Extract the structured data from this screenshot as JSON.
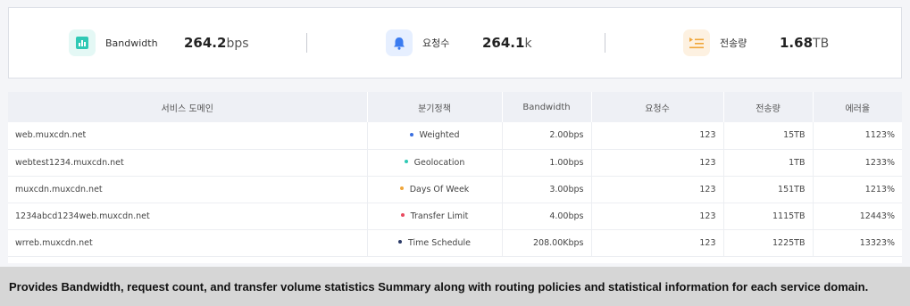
{
  "stats": [
    {
      "label": "Bandwidth",
      "value": "264.2",
      "unit": "bps",
      "icon": "bar-chart-icon",
      "icon_color": "#2fc9b5",
      "icon_bg": "#e4f8f5"
    },
    {
      "label": "요청수",
      "value": "264.1",
      "unit": "k",
      "icon": "bell-icon",
      "icon_color": "#3a7bf0",
      "icon_bg": "#e6efff"
    },
    {
      "label": "전송량",
      "value": "1.68",
      "unit": "TB",
      "icon": "list-play-icon",
      "icon_color": "#f0a63a",
      "icon_bg": "#fdf1e1"
    }
  ],
  "table": {
    "headers": [
      "서비스 도메인",
      "분기정책",
      "Bandwidth",
      "요청수",
      "전송량",
      "에러율"
    ],
    "rows": [
      {
        "domain": "web.muxcdn.net",
        "policy": "Weighted",
        "policy_color": "#3a6fe0",
        "bandwidth": "2.00bps",
        "requests": "123",
        "transfer": "15TB",
        "error_rate": "1123%"
      },
      {
        "domain": "webtest1234.muxcdn.net",
        "policy": "Geolocation",
        "policy_color": "#2fc9b5",
        "bandwidth": "1.00bps",
        "requests": "123",
        "transfer": "1TB",
        "error_rate": "1233%"
      },
      {
        "domain": "muxcdn.muxcdn.net",
        "policy": "Days Of Week",
        "policy_color": "#f0a63a",
        "bandwidth": "3.00bps",
        "requests": "123",
        "transfer": "151TB",
        "error_rate": "1213%"
      },
      {
        "domain": "1234abcd1234web.muxcdn.net",
        "policy": "Transfer Limit",
        "policy_color": "#e84a5f",
        "bandwidth": "4.00bps",
        "requests": "123",
        "transfer": "1115TB",
        "error_rate": "12443%"
      },
      {
        "domain": "wrreb.muxcdn.net",
        "policy": "Time Schedule",
        "policy_color": "#2b3a67",
        "bandwidth": "208.00Kbps",
        "requests": "123",
        "transfer": "1225TB",
        "error_rate": "13323%"
      }
    ]
  },
  "caption": "Provides Bandwidth, request count, and transfer volume statistics Summary along with routing policies and statistical information for each service domain."
}
